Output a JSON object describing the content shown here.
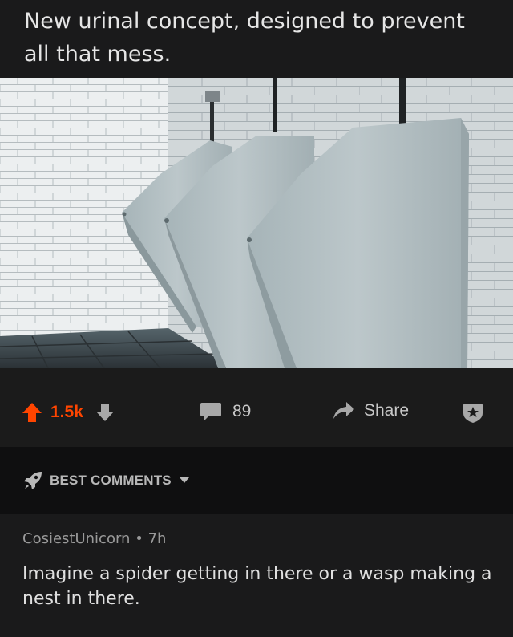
{
  "post": {
    "title": "New urinal concept, designed to prevent all that mess."
  },
  "actions": {
    "score": "1.5k",
    "comment_count": "89",
    "share_label": "Share",
    "accent_color": "#ff4500"
  },
  "comments_header": {
    "sort_label": "BEST COMMENTS"
  },
  "comment": {
    "author": "CosiestUnicorn",
    "separator": "•",
    "age": "7h",
    "text": "Imagine a spider getting in there or a wasp making a nest in there."
  },
  "icons": {
    "upvote": "upvote-icon",
    "downvote": "downvote-icon",
    "comment": "comment-icon",
    "share": "share-icon",
    "award": "award-icon",
    "sort": "rocket-icon",
    "caret": "chevron-down-icon"
  }
}
